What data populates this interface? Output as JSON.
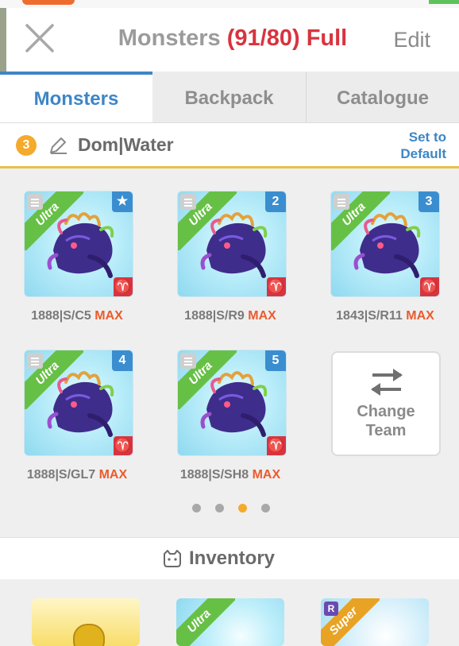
{
  "header": {
    "title_prefix": "Monsters",
    "title_count": "(91/80)",
    "title_status": "Full",
    "edit_label": "Edit",
    "close_icon": "close-icon"
  },
  "tabs": [
    {
      "label": "Monsters",
      "active": true
    },
    {
      "label": "Backpack",
      "active": false
    },
    {
      "label": "Catalogue",
      "active": false
    }
  ],
  "team": {
    "number": "3",
    "name": "Dom|Water",
    "set_default_line1": "Set to",
    "set_default_line2": "Default"
  },
  "monsters": [
    {
      "rarity": "Ultra",
      "slot": "★",
      "element": "♈",
      "code": "1888|S/C5",
      "level": "MAX"
    },
    {
      "rarity": "Ultra",
      "slot": "2",
      "element": "♈",
      "code": "1888|S/R9",
      "level": "MAX"
    },
    {
      "rarity": "Ultra",
      "slot": "3",
      "element": "♈",
      "code": "1843|S/R11",
      "level": "MAX"
    },
    {
      "rarity": "Ultra",
      "slot": "4",
      "element": "♈",
      "code": "1888|S/GL7",
      "level": "MAX"
    },
    {
      "rarity": "Ultra",
      "slot": "5",
      "element": "♈",
      "code": "1888|S/SH8",
      "level": "MAX"
    }
  ],
  "change_team": {
    "line1": "Change",
    "line2": "Team"
  },
  "pager": {
    "pages": 4,
    "current": 3
  },
  "inventory": {
    "label": "Inventory",
    "items": [
      {
        "kind": "gold"
      },
      {
        "kind": "blue",
        "rarity": "Ultra"
      },
      {
        "kind": "purple",
        "rarity": "Super",
        "badge": "R"
      }
    ]
  },
  "colors": {
    "accent_blue": "#3d86c6",
    "full_red": "#d8343f",
    "max_orange": "#ea5b2d",
    "ultra_green": "#67c046",
    "team_gold": "#f4aa2c"
  }
}
